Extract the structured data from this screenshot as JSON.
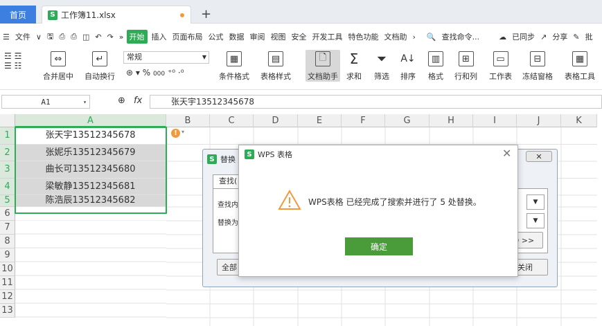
{
  "tabs": {
    "home": "首页",
    "file": "工作簿11.xlsx"
  },
  "menu": {
    "file": "文件",
    "items": [
      "开始",
      "插入",
      "页面布局",
      "公式",
      "数据",
      "审阅",
      "视图",
      "安全",
      "开发工具",
      "特色功能",
      "文档助"
    ],
    "search": "查找命令...",
    "sync": "已同步",
    "share": "分享",
    "comment": "批"
  },
  "toolbar": {
    "merge": "合并居中",
    "wrap": "自动换行",
    "numformat": "常规",
    "currency": "%",
    "thousands": "000",
    "cond_format": "条件格式",
    "table_style": "表格样式",
    "doc_helper": "文档助手",
    "sum": "求和",
    "filter": "筛选",
    "sort": "排序",
    "format": "格式",
    "rowcol": "行和列",
    "worksheet": "工作表",
    "freeze": "冻结窗格",
    "table_tools": "表格工具"
  },
  "formula_bar": {
    "cell_ref": "A1",
    "fx": "fx",
    "content": "张天宇13512345678"
  },
  "columns": [
    "A",
    "B",
    "C",
    "D",
    "E",
    "F",
    "G",
    "H",
    "I",
    "J",
    "K"
  ],
  "rows": [
    "1",
    "2",
    "3",
    "4",
    "5",
    "6",
    "7",
    "8",
    "9",
    "10",
    "11",
    "12",
    "13"
  ],
  "cells_a": [
    "张天宇13512345678",
    "张妮乐13512345679",
    "曲长可13512345680",
    "梁敏静13512345681",
    "陈浩辰13512345682"
  ],
  "replace_dialog": {
    "title": "替换",
    "tab": "查找(",
    "find_label": "查找内",
    "replace_label": "替换为",
    "options_btn": "D >>",
    "replace_all_btn": "全部",
    "close_btn": "关闭"
  },
  "alert": {
    "title": "WPS 表格",
    "message": "WPS表格 已经完成了搜索并进行了 5 处替换。",
    "ok": "确定"
  },
  "colors": {
    "accent": "#2dab57",
    "home_tab": "#3d7fe0",
    "ok_button": "#4a9c3b",
    "warning": "#f29a3b"
  }
}
